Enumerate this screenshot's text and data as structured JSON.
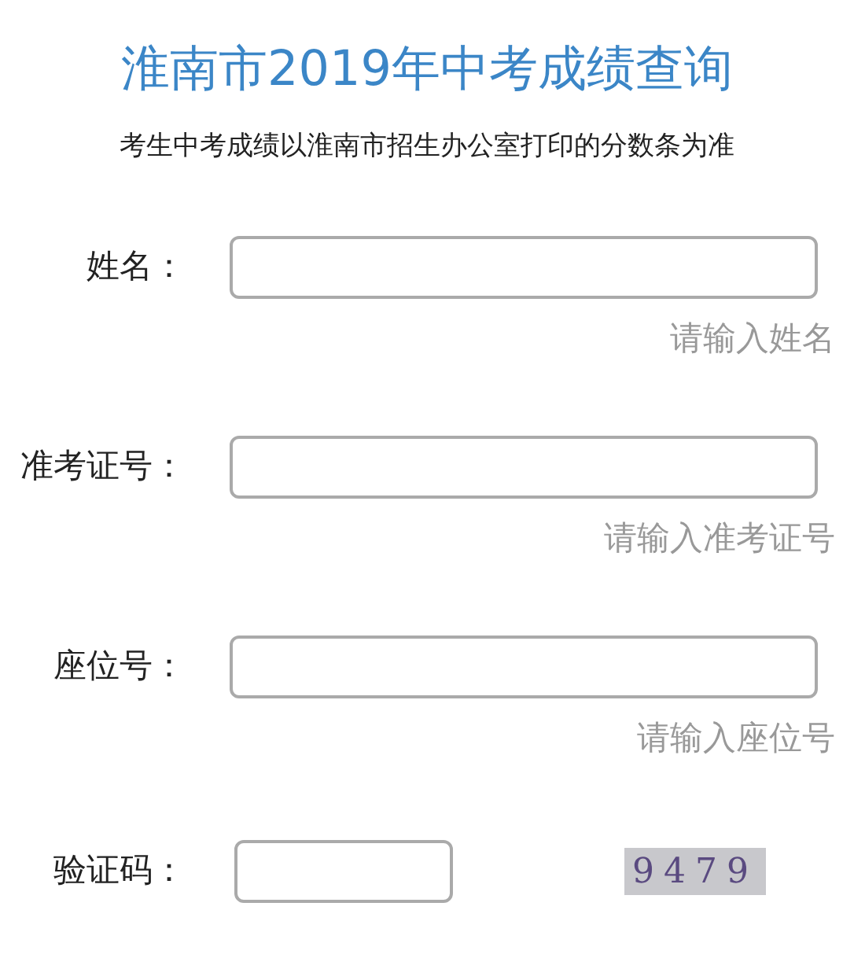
{
  "title": "淮南市2019年中考成绩查询",
  "notice": "考生中考成绩以淮南市招生办公室打印的分数条为准",
  "fields": [
    {
      "label": "姓名：",
      "hint": "请输入姓名"
    },
    {
      "label": "准考证号：",
      "hint": "请输入准考证号"
    },
    {
      "label": "座位号：",
      "hint": "请输入座位号"
    }
  ],
  "captcha": {
    "label": "验证码：",
    "code": "9479"
  }
}
